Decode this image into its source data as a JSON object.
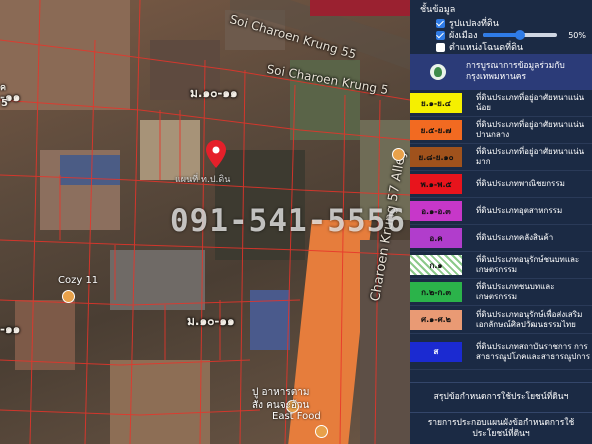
{
  "map": {
    "road_top": "Soi Charoen Krung 55",
    "road_soi": "Soi Charoen Krung 5",
    "road_vertical": "Charoen Krung 57 Alley",
    "zone_upper": "ม.๑๐-๑๑",
    "zone_lower": "ม.๑๐-๑๑",
    "zone_left_upper": "-๑๑",
    "zone_left_lower": "-๑๑",
    "left_edge_upper": "ค",
    "left_edge_num": "5",
    "phone": "091-541-5556",
    "pin_caption": "แผนที่ ท.ป.ดิน",
    "poi_cozy": "Cozy 11",
    "poi_food_line1": "ปู อาหารตาม",
    "poi_food_line2": "สั่ง คนจะอ้วน",
    "poi_food_line3": "East Food"
  },
  "panel": {
    "layers_title": "ชั้นข้อมูล",
    "layer_1": "รูปแปลงที่ดิน",
    "layer_2": "ผังเมือง",
    "layer_2_opacity": "50%",
    "layer_3": "ตำแหน่งโฉนดที่ดิน",
    "legend_header": "การบูรณาการข้อมูลร่วมกับ กรุงเทพมหานคร",
    "legend": [
      {
        "code": "ย.๑-ย.๔",
        "desc": "ที่ดินประเภทที่อยู่อาศัยหนาแน่นน้อย",
        "color": "#f5f000"
      },
      {
        "code": "ย.๕-ย.๗",
        "desc": "ที่ดินประเภทที่อยู่อาศัยหนาแน่นปานกลาง",
        "color": "#f26a21"
      },
      {
        "code": "ย.๘-ย.๑๐",
        "desc": "ที่ดินประเภทที่อยู่อาศัยหนาแน่นมาก",
        "color": "#a0521c"
      },
      {
        "code": "พ.๑-พ.๕",
        "desc": "ที่ดินประเภทพาณิชยกรรม",
        "color": "#e8141c"
      },
      {
        "code": "อ.๑-อ.๓",
        "desc": "ที่ดินประเภทอุตสาหกรรม",
        "color": "#c737c9"
      },
      {
        "code": "อ.ค",
        "desc": "ที่ดินประเภทคลังสินค้า",
        "color": "#b13dcc"
      },
      {
        "code": "ก.๑",
        "desc": "ที่ดินประเภทอนุรักษ์ชนบทและเกษตรกรรม",
        "color": "hatch"
      },
      {
        "code": "ก.๒-ก.๓",
        "desc": "ที่ดินประเภทชนบทและเกษตรกรรม",
        "color": "#2bb34a"
      },
      {
        "code": "ศ.๑-ศ.๒",
        "desc": "ที่ดินประเภทอนุรักษ์เพื่อส่งเสริมเอกลักษณ์ศิลปวัฒนธรรมไทย",
        "color": "#e99a74"
      },
      {
        "code": "ส",
        "desc": "ที่ดินประเภทสถาบันราชการ การสาธารณูปโภคและสาธารณูปการ",
        "color": "#1b2ad1"
      }
    ],
    "footer_1": "สรุปข้อกำหนดการใช้ประโยชน์ที่ดินฯ",
    "footer_2": "รายการประกอบแผนผังข้อกำหนดการใช้ประโยชน์ที่ดินฯ"
  }
}
